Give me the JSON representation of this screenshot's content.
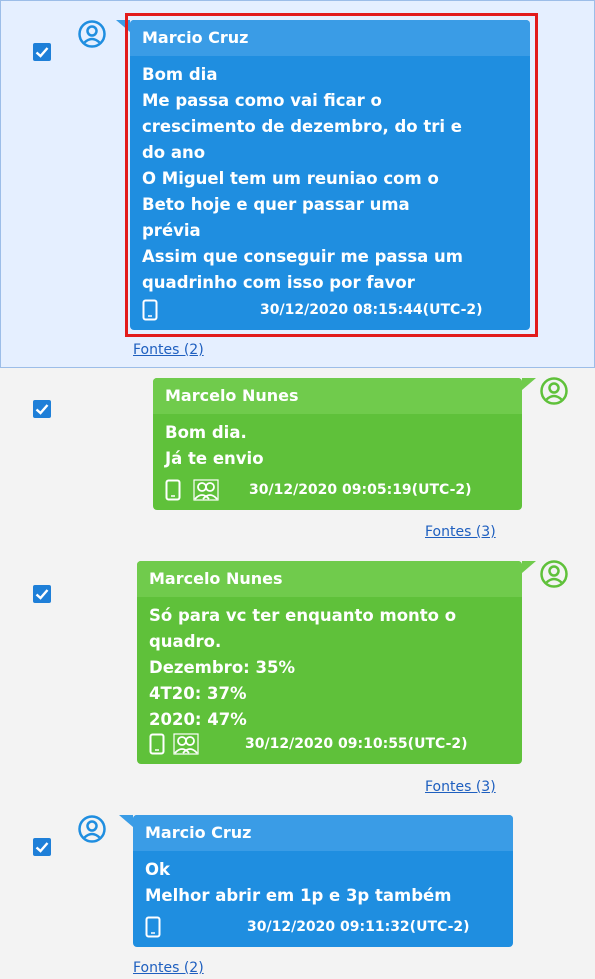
{
  "colors": {
    "blue": "#1f8ee0",
    "green": "#5fc13a",
    "link": "#1e5fbf",
    "highlight": "#e21b1b"
  },
  "messages": [
    {
      "sender": "Marcio Cruz",
      "lines": [
        "Bom dia",
        "Me passa como vai ficar o",
        "crescimento de dezembro, do tri e",
        "do ano",
        "O Miguel tem um reuniao com o",
        "Beto hoje e quer passar uma",
        "prévia",
        "Assim que conseguir me passa um",
        "quadrinho com isso por favor"
      ],
      "timestamp": "30/12/2020 08:15:44(UTC-2)",
      "sources": "Fontes (2)",
      "checked": true
    },
    {
      "sender": "Marcelo Nunes",
      "lines": [
        "Bom dia.",
        "Já te envio"
      ],
      "timestamp": "30/12/2020 09:05:19(UTC-2)",
      "sources": "Fontes (3)",
      "checked": true
    },
    {
      "sender": "Marcelo Nunes",
      "lines": [
        "Só para vc ter enquanto monto o",
        "quadro.",
        "Dezembro: 35%",
        "4T20: 37%",
        "2020: 47%"
      ],
      "timestamp": "30/12/2020 09:10:55(UTC-2)",
      "sources": "Fontes (3)",
      "checked": true
    },
    {
      "sender": "Marcio Cruz",
      "lines": [
        "Ok",
        "Melhor abrir em 1p e 3p também"
      ],
      "timestamp": "30/12/2020 09:11:32(UTC-2)",
      "sources": "Fontes (2)",
      "checked": true
    }
  ]
}
